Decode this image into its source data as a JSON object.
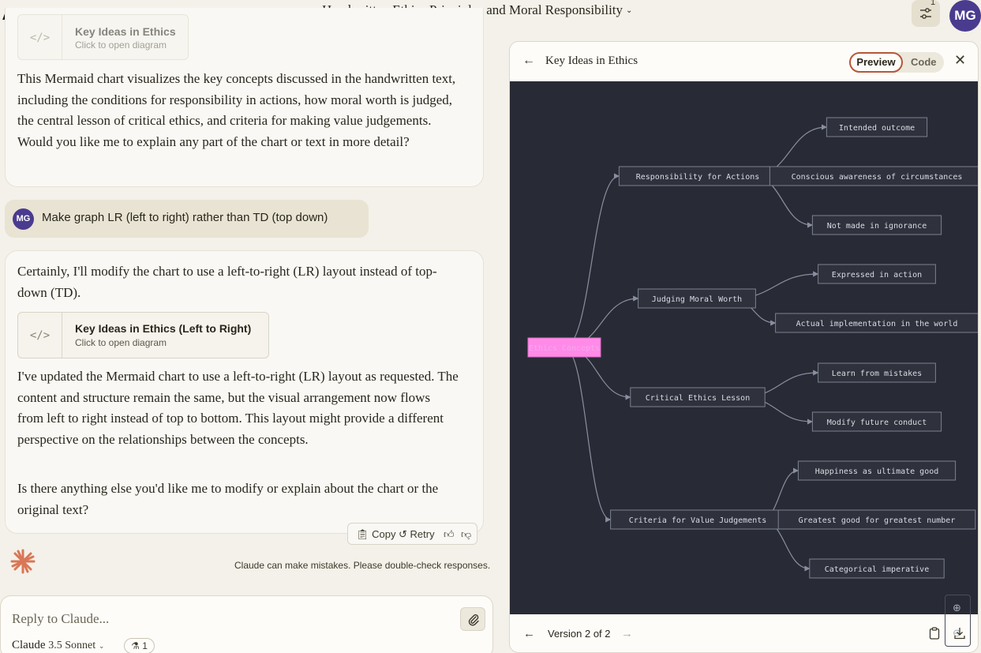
{
  "header": {
    "logo_text": "A\\",
    "chat_title": "Handwritten Ethics Principles and Moral Responsibility",
    "settings_badge": "1",
    "user_initials": "MG"
  },
  "messages": {
    "first_artifact": {
      "title": "Key Ideas in Ethics",
      "subtitle": "Click to open diagram"
    },
    "first_reply": "This Mermaid chart visualizes the key concepts discussed in the handwritten text, including the conditions for responsibility in actions, how moral worth is judged, the central lesson of critical ethics, and criteria for making value judgements. Would you like me to explain any part of the chart or text in more detail?",
    "user_initials": "MG",
    "user_prompt": "Make graph LR (left to right) rather than TD (top down)",
    "second_intro": "Certainly, I'll modify the chart to use a left-to-right (LR) layout instead of top-down (TD).",
    "second_artifact": {
      "title": "Key Ideas in Ethics (Left to Right)",
      "subtitle": "Click to open diagram"
    },
    "second_body": "I've updated the Mermaid chart to use a left-to-right (LR) layout as requested. The content and structure remain the same, but the visual arrangement now flows from left to right instead of top to bottom. This layout might provide a different perspective on the relationships between the concepts.",
    "second_closing": "Is there anything else you'd like me to modify or explain about the chart or the original text?"
  },
  "actions": {
    "copy": "Copy",
    "retry": "Retry"
  },
  "disclaimer": "Claude can make mistakes. Please double-check responses.",
  "composer": {
    "placeholder": "Reply to Claude...",
    "model_name": "Claude",
    "model_version": "3.5 Sonnet",
    "project_count": "1"
  },
  "panel": {
    "title": "Key Ideas in Ethics",
    "preview_label": "Preview",
    "code_label": "Code",
    "version_label": "Version 2 of 2"
  },
  "diagram": {
    "root": "Ethics Concepts",
    "branches": [
      {
        "label": "Responsibility for Actions",
        "children": [
          "Intended outcome",
          "Conscious awareness of circumstances",
          "Not made in ignorance"
        ]
      },
      {
        "label": "Judging Moral Worth",
        "children": [
          "Expressed in action",
          "Actual implementation in the world"
        ]
      },
      {
        "label": "Critical Ethics Lesson",
        "children": [
          "Learn from mistakes",
          "Modify future conduct"
        ]
      },
      {
        "label": "Criteria for Value Judgements",
        "children": [
          "Happiness as ultimate good",
          "Greatest good for greatest number",
          "Categorical imperative"
        ]
      }
    ],
    "colors": {
      "background": "#282b35",
      "node_fill": "#2f323d",
      "node_stroke": "#7c8090",
      "root_fill": "#ff8ae8",
      "edge": "#8a8ea0",
      "text": "#d8dbe2"
    }
  }
}
